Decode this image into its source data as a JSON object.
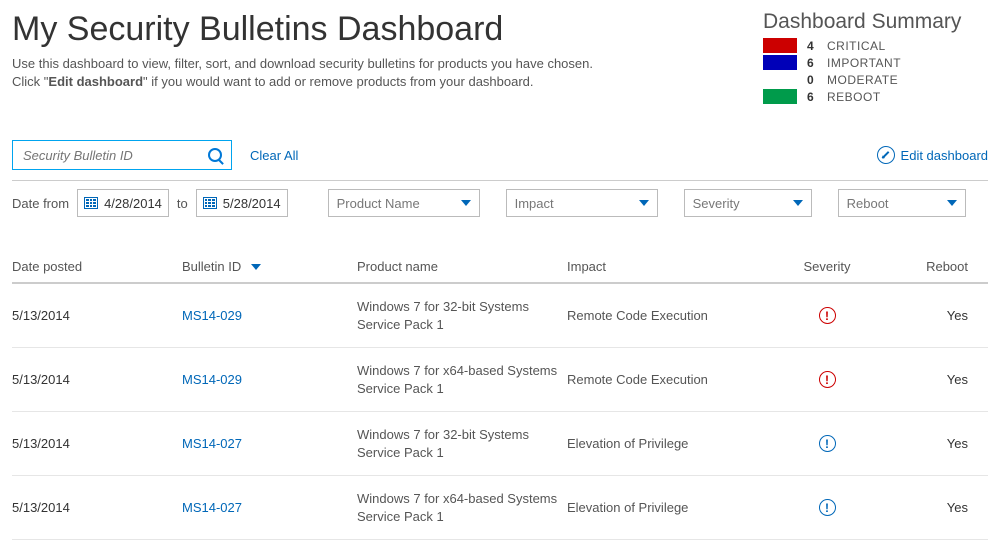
{
  "header": {
    "title": "My Security Bulletins Dashboard",
    "subtitle_pre": "Use this dashboard to view, filter, sort, and download security bulletins for products you have chosen. Click \"",
    "subtitle_bold": "Edit dashboard",
    "subtitle_post": "\" if you would want to add or remove products from your dashboard."
  },
  "summary": {
    "title": "Dashboard Summary",
    "items": [
      {
        "count": "4",
        "label": "CRITICAL"
      },
      {
        "count": "6",
        "label": "IMPORTANT"
      },
      {
        "count": "0",
        "label": "MODERATE"
      },
      {
        "count": "6",
        "label": "REBOOT"
      }
    ]
  },
  "search": {
    "placeholder": "Security Bulletin ID"
  },
  "actions": {
    "clear_all": "Clear All",
    "edit_dashboard": "Edit dashboard"
  },
  "filters": {
    "date_from_label": "Date from",
    "date_from": "4/28/2014",
    "date_to_label": "to",
    "date_to": "5/28/2014",
    "product_name": "Product Name",
    "impact": "Impact",
    "severity": "Severity",
    "reboot": "Reboot"
  },
  "columns": {
    "date_posted": "Date posted",
    "bulletin_id": "Bulletin ID",
    "product_name": "Product name",
    "impact": "Impact",
    "severity": "Severity",
    "reboot": "Reboot"
  },
  "rows": [
    {
      "date": "5/13/2014",
      "bid": "MS14-029",
      "product": "Windows 7 for 32-bit Systems Service Pack 1",
      "impact": "Remote Code Execution",
      "sev": "critical",
      "reboot": "Yes"
    },
    {
      "date": "5/13/2014",
      "bid": "MS14-029",
      "product": "Windows 7 for x64-based Systems Service Pack 1",
      "impact": "Remote Code Execution",
      "sev": "critical",
      "reboot": "Yes"
    },
    {
      "date": "5/13/2014",
      "bid": "MS14-027",
      "product": "Windows 7 for 32-bit Systems Service Pack 1",
      "impact": "Elevation of Privilege",
      "sev": "important",
      "reboot": "Yes"
    },
    {
      "date": "5/13/2014",
      "bid": "MS14-027",
      "product": "Windows 7 for x64-based Systems Service Pack 1",
      "impact": "Elevation of Privilege",
      "sev": "important",
      "reboot": "Yes"
    }
  ]
}
